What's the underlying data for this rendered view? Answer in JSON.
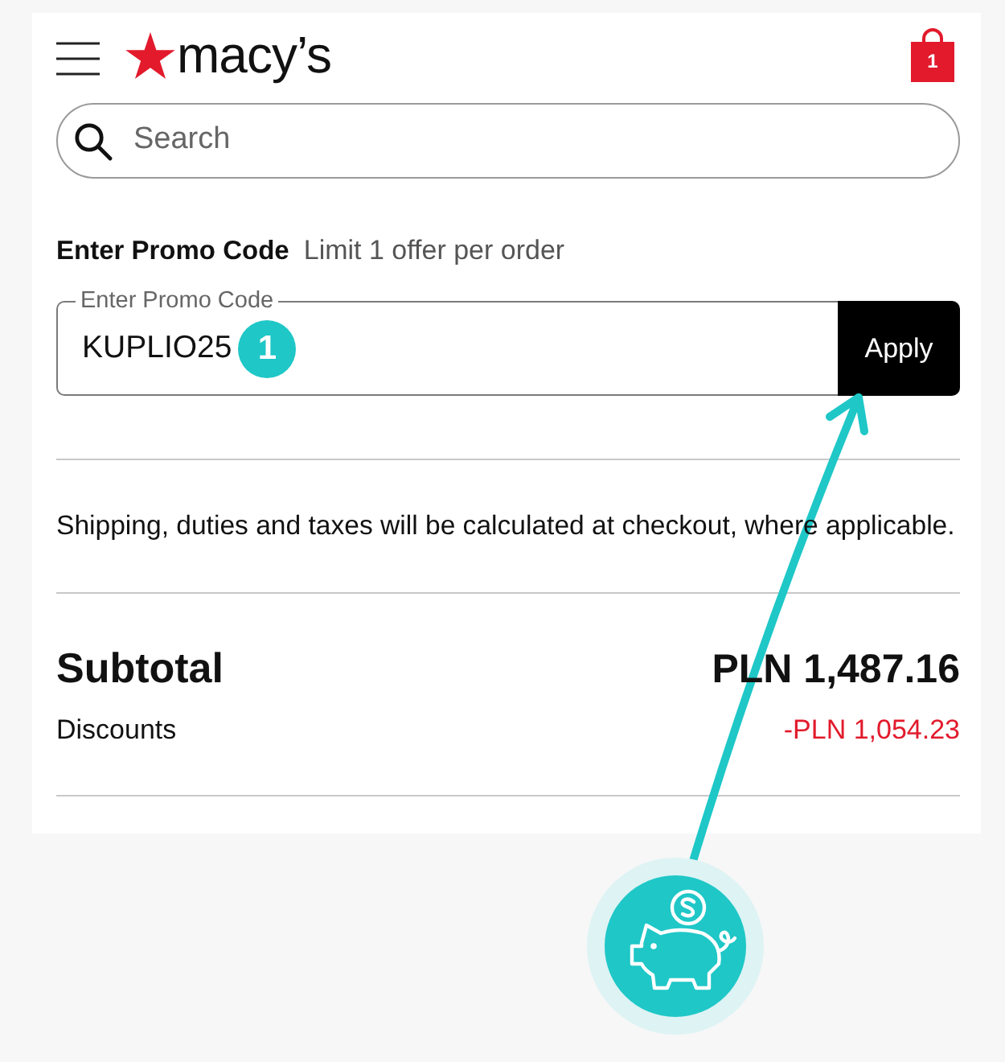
{
  "header": {
    "logo": "macy’s",
    "cart_count": "1"
  },
  "search": {
    "placeholder": "Search"
  },
  "promo": {
    "heading": "Enter Promo Code",
    "note": "Limit 1 offer per order",
    "field_label": "Enter Promo Code",
    "value": "KUPLIO25",
    "step_marker": "1",
    "button": "Apply"
  },
  "notice": "Shipping, duties and taxes will be calculated at checkout, where applicable.",
  "summary": [
    {
      "kind": "total",
      "label": "Subtotal",
      "amount": "PLN 1,487.16"
    },
    {
      "kind": "discount",
      "label": "Discounts",
      "amount": "-PLN 1,054.23"
    }
  ]
}
